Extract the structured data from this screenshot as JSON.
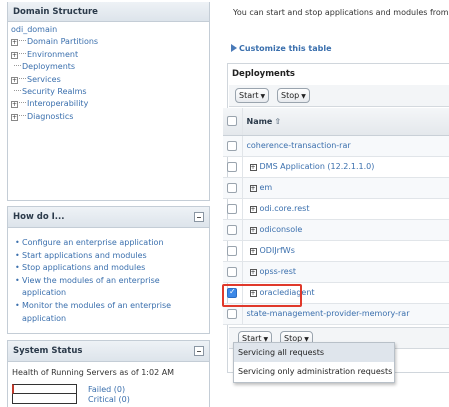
{
  "domain_panel": {
    "title": "Domain Structure",
    "tree": [
      {
        "label": "odi_domain",
        "expandable": false
      },
      {
        "label": "Domain Partitions",
        "expandable": true
      },
      {
        "label": "Environment",
        "expandable": true
      },
      {
        "label": "Deployments",
        "expandable": false
      },
      {
        "label": "Services",
        "expandable": true
      },
      {
        "label": "Security Realms",
        "expandable": false
      },
      {
        "label": "Interoperability",
        "expandable": true
      },
      {
        "label": "Diagnostics",
        "expandable": true
      }
    ]
  },
  "how_panel": {
    "title": "How do I...",
    "items": [
      "Configure an enterprise application",
      "Start applications and modules",
      "Stop applications and modules",
      "View the modules of an enterprise application",
      "Monitor the modules of an enterprise application"
    ]
  },
  "status_panel": {
    "title": "System Status",
    "health_text": "Health of Running Servers as of  1:02 AM",
    "legend": [
      "Failed (0)",
      "Critical (0)"
    ]
  },
  "main": {
    "intro": "You can start and stop applications and modules from",
    "customize_link": "Customize this table",
    "deployments_title": "Deployments",
    "start_label": "Start",
    "stop_label": "Stop",
    "name_header": "Name",
    "rows": [
      {
        "name": "coherence-transaction-rar",
        "expandable": false,
        "checked": false
      },
      {
        "name": "DMS Application (12.2.1.1.0)",
        "expandable": true,
        "checked": false
      },
      {
        "name": "em",
        "expandable": true,
        "checked": false
      },
      {
        "name": "odi.core.rest",
        "expandable": true,
        "checked": false
      },
      {
        "name": "odiconsole",
        "expandable": true,
        "checked": false
      },
      {
        "name": "ODIJrfWs",
        "expandable": true,
        "checked": false
      },
      {
        "name": "opss-rest",
        "expandable": true,
        "checked": false
      },
      {
        "name": "oraclediagent",
        "expandable": true,
        "checked": true
      },
      {
        "name": "state-management-provider-memory-rar",
        "expandable": false,
        "checked": false
      }
    ]
  },
  "start_menu": {
    "items": [
      "Servicing all requests",
      "Servicing only administration requests"
    ]
  },
  "colors": {
    "link": "#3a6fad",
    "highlight_border": "#e0392b",
    "checkbox_checked": "#3b88e8"
  }
}
